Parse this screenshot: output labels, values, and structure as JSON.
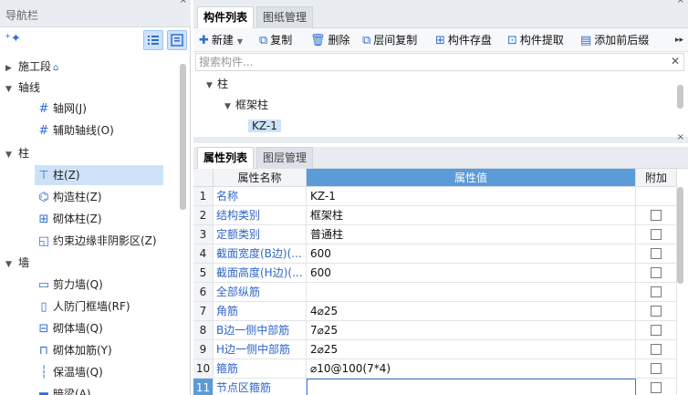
{
  "nav": {
    "title": "导航栏",
    "items": [
      {
        "label": "施工段",
        "level": 0,
        "expanded": false,
        "suffix_icon": "lock-icon"
      },
      {
        "label": "轴线",
        "level": 0,
        "expanded": true
      },
      {
        "label": "轴网(J)",
        "level": 1,
        "icon": "grid-icon"
      },
      {
        "label": "辅助轴线(O)",
        "level": 1,
        "icon": "grid-icon"
      },
      {
        "label": "柱",
        "level": 0,
        "expanded": true
      },
      {
        "label": "柱(Z)",
        "level": 1,
        "icon": "column-icon",
        "selected": true
      },
      {
        "label": "构造柱(Z)",
        "level": 1,
        "icon": "constructional-column-icon"
      },
      {
        "label": "砌体柱(Z)",
        "level": 1,
        "icon": "masonry-column-icon"
      },
      {
        "label": "约束边缘非阴影区(Z)",
        "level": 1,
        "icon": "edge-zone-icon"
      },
      {
        "label": "墙",
        "level": 0,
        "expanded": true
      },
      {
        "label": "剪力墙(Q)",
        "level": 1,
        "icon": "shear-wall-icon"
      },
      {
        "label": "人防门框墙(RF)",
        "level": 1,
        "icon": "door-frame-wall-icon"
      },
      {
        "label": "砌体墙(Q)",
        "level": 1,
        "icon": "masonry-wall-icon"
      },
      {
        "label": "砌体加筋(Y)",
        "level": 1,
        "icon": "masonry-rebar-icon"
      },
      {
        "label": "保温墙(Q)",
        "level": 1,
        "icon": "insulation-wall-icon"
      },
      {
        "label": "暗梁(A)",
        "level": 1,
        "icon": "hidden-beam-icon"
      }
    ]
  },
  "component_panel": {
    "tabs": [
      "构件列表",
      "图纸管理"
    ],
    "toolbar": [
      {
        "label": "新建",
        "icon": "new-icon",
        "has_dropdown": true
      },
      {
        "label": "复制",
        "icon": "copy-icon"
      },
      {
        "label": "删除",
        "icon": "delete-icon"
      },
      {
        "label": "层间复制",
        "icon": "layer-copy-icon"
      },
      {
        "label": "构件存盘",
        "icon": "save-component-icon"
      },
      {
        "label": "构件提取",
        "icon": "extract-component-icon"
      },
      {
        "label": "添加前后缀",
        "icon": "prefix-suffix-icon"
      }
    ],
    "search_placeholder": "搜索构件...",
    "tree": [
      {
        "label": "柱",
        "level": 0
      },
      {
        "label": "框架柱",
        "level": 1
      },
      {
        "label": "KZ-1",
        "level": 2,
        "selected": true
      }
    ]
  },
  "property_panel": {
    "tabs": [
      "属性列表",
      "图层管理"
    ],
    "headers": {
      "name": "属性名称",
      "value": "属性值",
      "extra": "附加"
    },
    "rows": [
      {
        "n": "1",
        "name": "名称",
        "value": "KZ-1",
        "checkbox": false
      },
      {
        "n": "2",
        "name": "结构类别",
        "value": "框架柱",
        "checkbox": true
      },
      {
        "n": "3",
        "name": "定额类别",
        "value": "普通柱",
        "checkbox": true
      },
      {
        "n": "4",
        "name": "截面宽度(B边)(...",
        "value": "600",
        "checkbox": true
      },
      {
        "n": "5",
        "name": "截面高度(H边)(...",
        "value": "600",
        "checkbox": true
      },
      {
        "n": "6",
        "name": "全部纵筋",
        "value": "",
        "checkbox": true
      },
      {
        "n": "7",
        "name": "角筋",
        "value": "4⌀25",
        "checkbox": true
      },
      {
        "n": "8",
        "name": "B边一侧中部筋",
        "value": "7⌀25",
        "checkbox": true
      },
      {
        "n": "9",
        "name": "H边一侧中部筋",
        "value": "2⌀25",
        "checkbox": true
      },
      {
        "n": "10",
        "name": "箍筋",
        "value": "⌀10@100(7*4)",
        "checkbox": true
      },
      {
        "n": "11",
        "name": "节点区箍筋",
        "value": "",
        "checkbox": true,
        "editing": true
      }
    ]
  },
  "colors": {
    "accent": "#2e6fd0",
    "selection": "#cde2f8",
    "header_blue": "#5b9bd8",
    "panel_bg": "#e9edf2"
  }
}
